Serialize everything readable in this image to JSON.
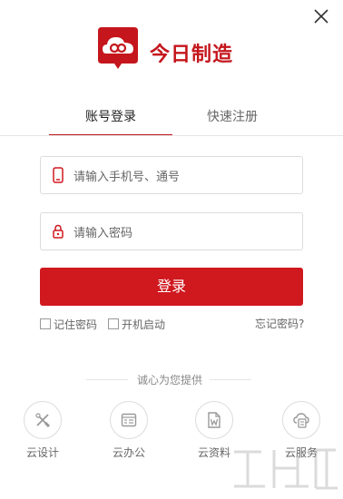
{
  "brand": {
    "name": "今日制造",
    "color": "#c4161c",
    "logo_icon": "cloud-link-logo"
  },
  "window": {
    "close_icon": "close-icon"
  },
  "tabs": [
    {
      "label": "账号登录",
      "active": true
    },
    {
      "label": "快速注册",
      "active": false
    }
  ],
  "form": {
    "phone": {
      "placeholder": "请输入手机号、通号",
      "icon": "phone-icon"
    },
    "password": {
      "placeholder": "请输入密码",
      "icon": "lock-icon"
    },
    "submit_label": "登录",
    "submit_color": "#d0181f",
    "remember_label": "记住密码",
    "remember_checked": false,
    "autostart_label": "开机启动",
    "autostart_checked": false,
    "forgot_label": "忘记密码?"
  },
  "services": {
    "heading": "诚心为您提供",
    "items": [
      {
        "label": "云设计",
        "icon": "design-tools-icon"
      },
      {
        "label": "云办公",
        "icon": "office-icon"
      },
      {
        "label": "云资料",
        "icon": "document-icon"
      },
      {
        "label": "云服务",
        "icon": "cloud-service-icon"
      }
    ]
  }
}
